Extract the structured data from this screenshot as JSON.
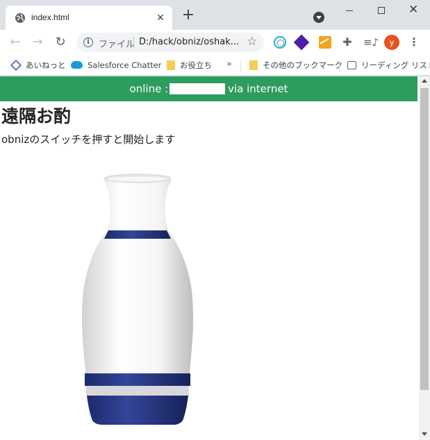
{
  "browser": {
    "tab": {
      "title": "index.html",
      "close": "✕"
    },
    "new_tab": "+",
    "window": {
      "close": "✕"
    },
    "nav": {
      "back": "←",
      "forward": "→",
      "reload": "↻"
    },
    "omnibox": {
      "info": "i",
      "label": "ファイル",
      "url": "D:/hack/obniz/oshak..."
    },
    "star": "☆",
    "extensions_icon": "✚",
    "reading_list_icon": "≡♪",
    "profile_initial": "y",
    "menu": "⋮",
    "bookmarks": [
      {
        "label": "あいねっと",
        "icon": "diamond-icon"
      },
      {
        "label": "Salesforce Chatter",
        "icon": "cloud-icon"
      },
      {
        "label": "お役立ち",
        "icon": "folder-icon"
      }
    ],
    "more_bookmarks": "»",
    "other_bookmarks": "その他のブックマーク",
    "reading_list": "リーディング リスト"
  },
  "page": {
    "status_prefix": "online :",
    "status_suffix": "via internet",
    "title": "遠隔お酌",
    "subtitle": "obnizのスイッチを押すと開始します"
  },
  "colors": {
    "status_green": "#2e9b5f",
    "band_navy": "#27357a"
  }
}
